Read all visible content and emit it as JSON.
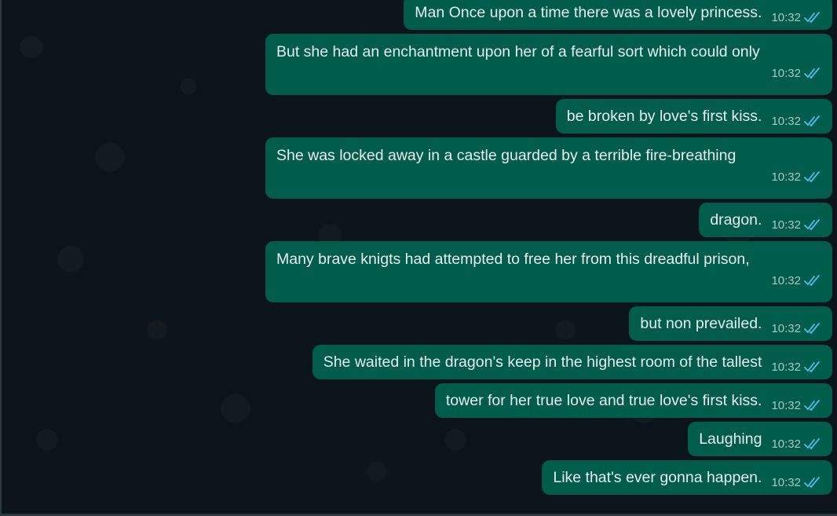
{
  "conversation": {
    "messages": [
      {
        "text": "Man Once upon a time there was a lovely princess.",
        "time": "10:32",
        "status_icon": "double-check-read-icon"
      },
      {
        "text": "But she had an enchantment upon her of a fearful sort which could only",
        "time": "10:32",
        "status_icon": "double-check-read-icon"
      },
      {
        "text": "be broken by love's first kiss.",
        "time": "10:32",
        "status_icon": "double-check-read-icon"
      },
      {
        "text": "She was locked away in a castle guarded by a terrible fire-breathing",
        "time": "10:32",
        "status_icon": "double-check-read-icon"
      },
      {
        "text": "dragon.",
        "time": "10:32",
        "status_icon": "double-check-read-icon"
      },
      {
        "text": "Many brave knigts had attempted to free her from this dreadful prison,",
        "time": "10:32",
        "status_icon": "double-check-read-icon"
      },
      {
        "text": "but non prevailed.",
        "time": "10:32",
        "status_icon": "double-check-read-icon"
      },
      {
        "text": "She waited in the dragon's keep in the highest room of the tallest",
        "time": "10:32",
        "status_icon": "double-check-read-icon"
      },
      {
        "text": "tower for her true love and true love's first kiss.",
        "time": "10:32",
        "status_icon": "double-check-read-icon"
      },
      {
        "text": "Laughing",
        "time": "10:32",
        "status_icon": "double-check-read-icon"
      },
      {
        "text": "Like that's ever gonna happen.",
        "time": "10:32",
        "status_icon": "double-check-read-icon"
      }
    ]
  },
  "colors": {
    "background": "#0b141a",
    "outgoing_bubble": "#005c4b",
    "message_text": "#e9edef",
    "read_tick": "#53bdeb",
    "timestamp": "#a9c8c1"
  }
}
